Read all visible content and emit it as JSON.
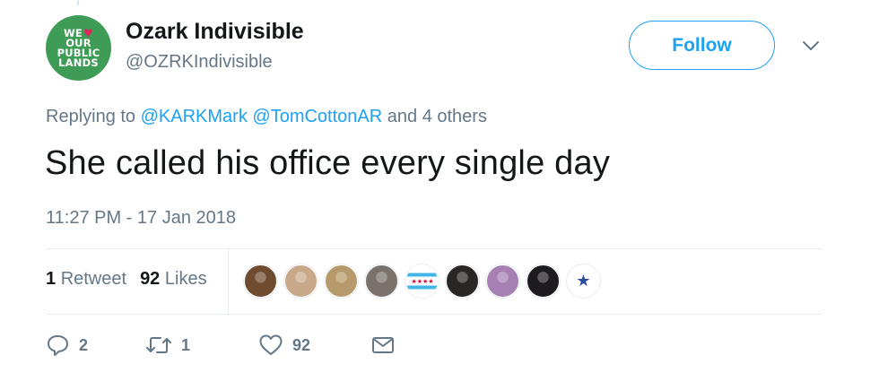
{
  "author": {
    "name": "Ozark Indivisible",
    "handle": "@OZRKIndivisible",
    "avatar": {
      "lines": [
        "WE",
        "OUR",
        "PUBLIC",
        "LANDS"
      ],
      "heart": "♥",
      "bg_color": "#3f9c56"
    }
  },
  "header": {
    "follow_label": "Follow",
    "menu_icon": "chevron-down-icon"
  },
  "replying": {
    "prefix": "Replying to",
    "mentions": [
      "@KARKMark",
      "@TomCottonAR"
    ],
    "suffix": "and 4 others"
  },
  "tweet": {
    "text": "She called his office every single day",
    "timestamp": "11:27 PM - 17 Jan 2018"
  },
  "stats": {
    "retweets_count": "1",
    "retweets_label": "Retweet",
    "likes_count": "92",
    "likes_label": "Likes"
  },
  "likers": [
    {
      "icon": "avatar-dog",
      "color": "#6f4b2f"
    },
    {
      "icon": "avatar-woman",
      "color": "#c9a88a"
    },
    {
      "icon": "avatar-sign",
      "color": "#b79a6b"
    },
    {
      "icon": "avatar-building",
      "color": "#7a726a"
    },
    {
      "icon": "avatar-chicago-flag",
      "color": "#41b6e6"
    },
    {
      "icon": "avatar-dark",
      "color": "#2b2626"
    },
    {
      "icon": "avatar-we-stand",
      "color": "#a67fb3"
    },
    {
      "icon": "avatar-person",
      "color": "#1d1b1f"
    },
    {
      "icon": "avatar-star",
      "color": "#ffffff"
    }
  ],
  "actions": {
    "reply_count": "2",
    "retweet_count": "1",
    "like_count": "92"
  },
  "colors": {
    "accent": "#1da1f2",
    "muted_text": "#657786",
    "primary_text": "#14171a",
    "divider": "#e6ecf0"
  }
}
